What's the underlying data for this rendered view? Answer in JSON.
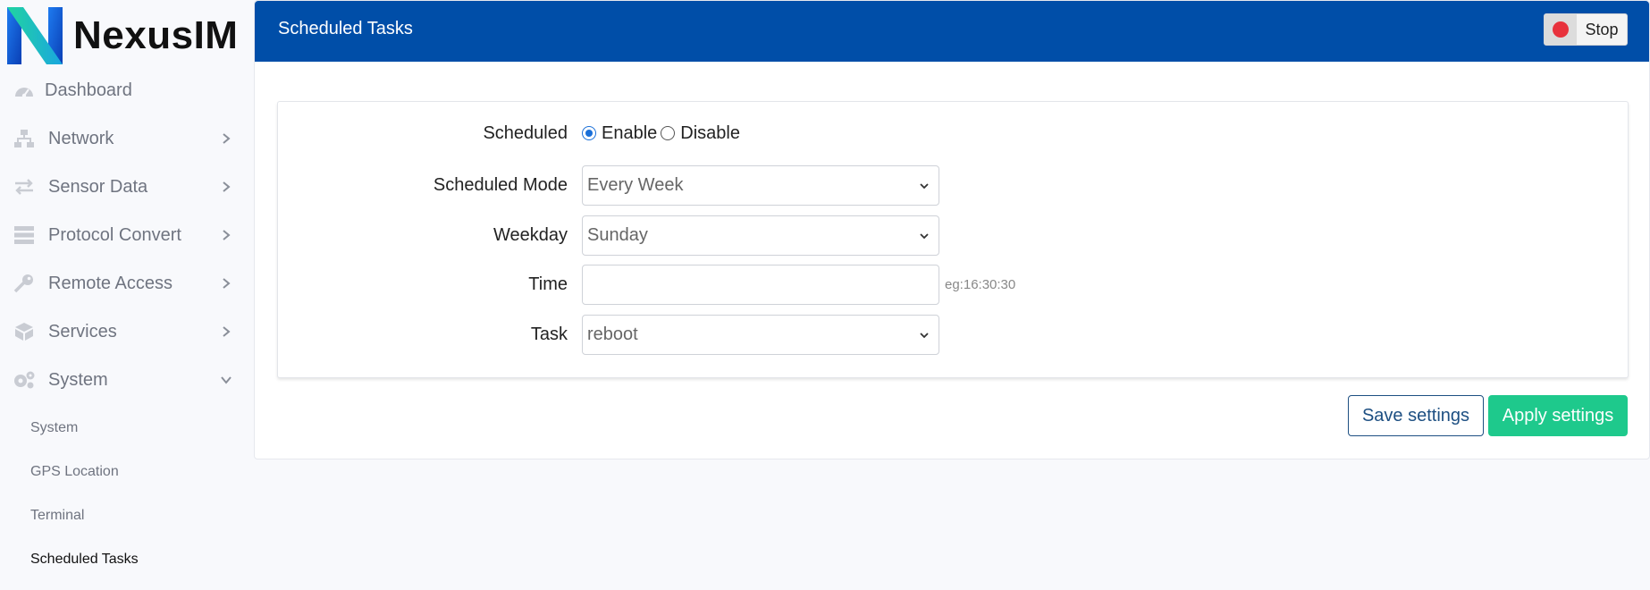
{
  "brand": {
    "name": "NexusIM"
  },
  "sidebar": {
    "items": [
      {
        "label": "Dashboard",
        "icon": "dashboard-gauge-icon"
      },
      {
        "label": "Network",
        "icon": "network-icon"
      },
      {
        "label": "Sensor Data",
        "icon": "exchange-arrows-icon"
      },
      {
        "label": "Protocol Convert",
        "icon": "server-stack-icon"
      },
      {
        "label": "Remote Access",
        "icon": "key-icon"
      },
      {
        "label": "Services",
        "icon": "cube-icon"
      },
      {
        "label": "System",
        "icon": "gears-icon"
      }
    ],
    "system_sub": [
      {
        "label": "System"
      },
      {
        "label": "GPS Location"
      },
      {
        "label": "Terminal"
      },
      {
        "label": "Scheduled Tasks"
      }
    ]
  },
  "header": {
    "title": "Scheduled Tasks",
    "stop_label": "Stop",
    "stop_color": "#e8323c"
  },
  "form": {
    "scheduled": {
      "label": "Scheduled",
      "enable": "Enable",
      "disable": "Disable",
      "selected": "Enable"
    },
    "mode": {
      "label": "Scheduled Mode",
      "value": "Every Week"
    },
    "weekday": {
      "label": "Weekday",
      "value": "Sunday"
    },
    "time": {
      "label": "Time",
      "value": "",
      "placeholder": "",
      "hint": "eg:16:30:30"
    },
    "task": {
      "label": "Task",
      "value": "reboot"
    }
  },
  "actions": {
    "save": "Save settings",
    "apply": "Apply settings"
  },
  "colors": {
    "header_bg": "#004ea8",
    "apply_bg": "#1ec98c",
    "save_border": "#1d4f82"
  }
}
